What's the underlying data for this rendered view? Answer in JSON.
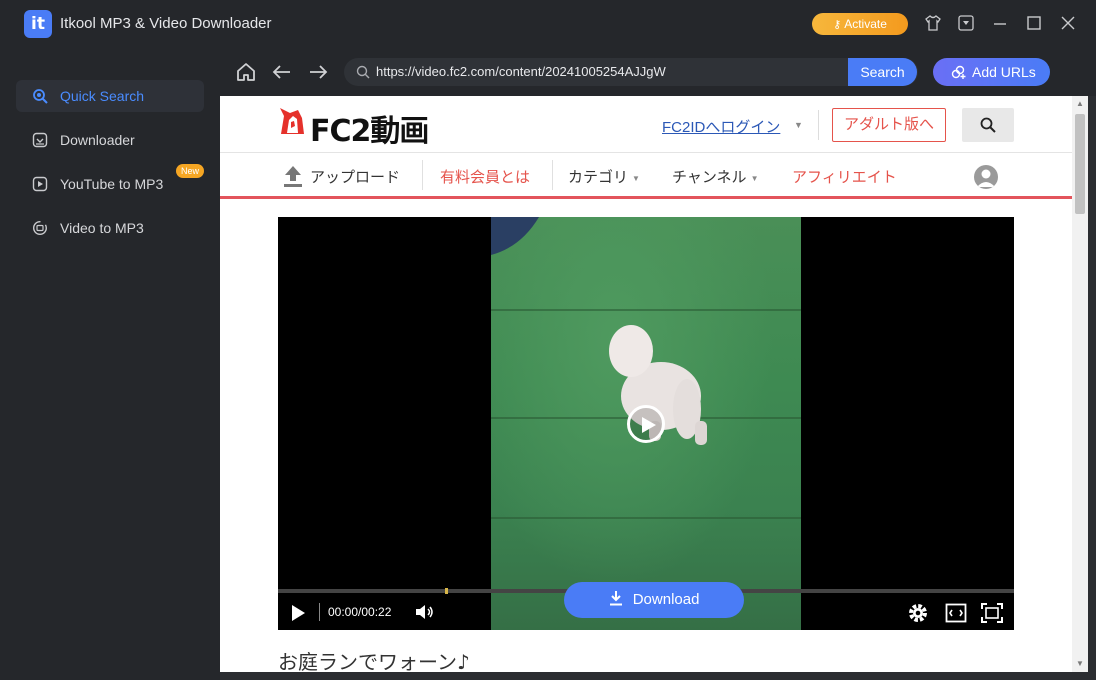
{
  "app": {
    "title": "Itkool MP3 & Video Downloader",
    "logo_text": "it",
    "activate_label": "Activate"
  },
  "sidebar": {
    "items": [
      {
        "label": "Quick Search",
        "icon": "search-icon",
        "active": true
      },
      {
        "label": "Downloader",
        "icon": "download-box-icon",
        "active": false
      },
      {
        "label": "YouTube to MP3",
        "icon": "play-box-icon",
        "active": false,
        "badge": "New"
      },
      {
        "label": "Video to MP3",
        "icon": "convert-icon",
        "active": false
      }
    ]
  },
  "toolbar": {
    "url": "https://video.fc2.com/content/20241005254AJJgW",
    "search_label": "Search",
    "add_urls_label": "Add URLs"
  },
  "fc2": {
    "logo_text": "FC2動画",
    "login_link": "FC2IDへログイン",
    "adult_button": "アダルト版へ",
    "nav": {
      "upload": "アップロード",
      "premium": "有料会員とは",
      "category": "カテゴリ",
      "channel": "チャンネル",
      "affiliate": "アフィリエイト"
    }
  },
  "video": {
    "time": "00:00/00:22",
    "download_label": "Download",
    "caption": "お庭ランでワォーン♪",
    "progress_fraction": 0
  },
  "colors": {
    "accent": "#4a7cf6",
    "sidebar_bg": "#25272b",
    "activate": "#f39a1e",
    "fc2_red": "#e5534b"
  }
}
